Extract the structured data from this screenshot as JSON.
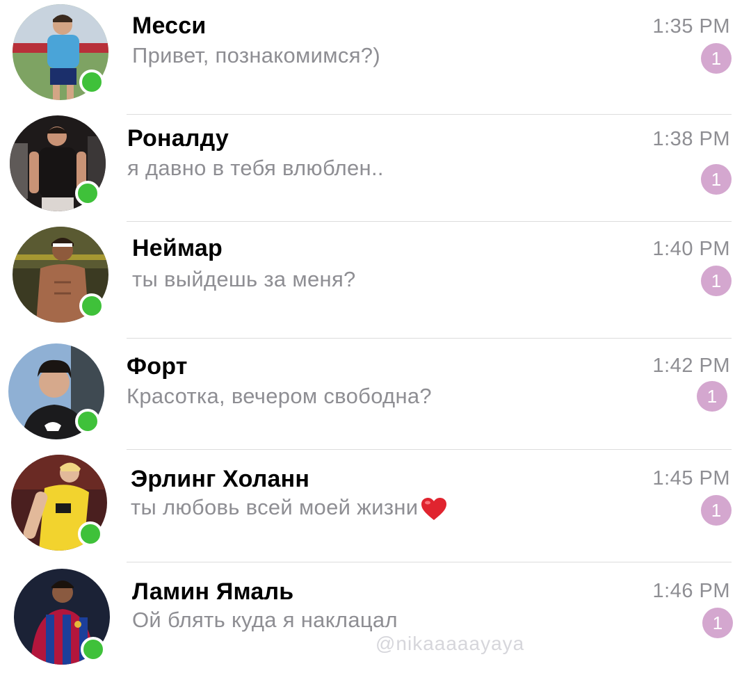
{
  "colors": {
    "online": "#3fc13a",
    "badge": "#d4a7cf",
    "secondary_text": "#8e8e93",
    "divider": "#dcdcdc"
  },
  "chats": [
    {
      "name": "Месси",
      "message": "Привет, познакомимся?)",
      "time": "1:35 PM",
      "unread": "1",
      "online": true
    },
    {
      "name": "Роналду",
      "message": "я давно в тебя влюблен..",
      "time": "1:38 PM",
      "unread": "1",
      "online": true
    },
    {
      "name": "Неймар",
      "message": "ты выйдешь за меня?",
      "time": "1:40 PM",
      "unread": "1",
      "online": true
    },
    {
      "name": "Форт",
      "message": "Красотка, вечером свободна?",
      "time": "1:42 PM",
      "unread": "1",
      "online": true
    },
    {
      "name": "Эрлинг Холанн",
      "message": "ты любовь всей моей жизни",
      "time": "1:45 PM",
      "unread": "1",
      "online": true,
      "emoji": "heart-icon"
    },
    {
      "name": "Ламин Ямаль",
      "message": "Ой блять куда я наклацал",
      "time": "1:46 PM",
      "unread": "1",
      "online": true
    }
  ],
  "watermark": "@nikaaaaayaya"
}
